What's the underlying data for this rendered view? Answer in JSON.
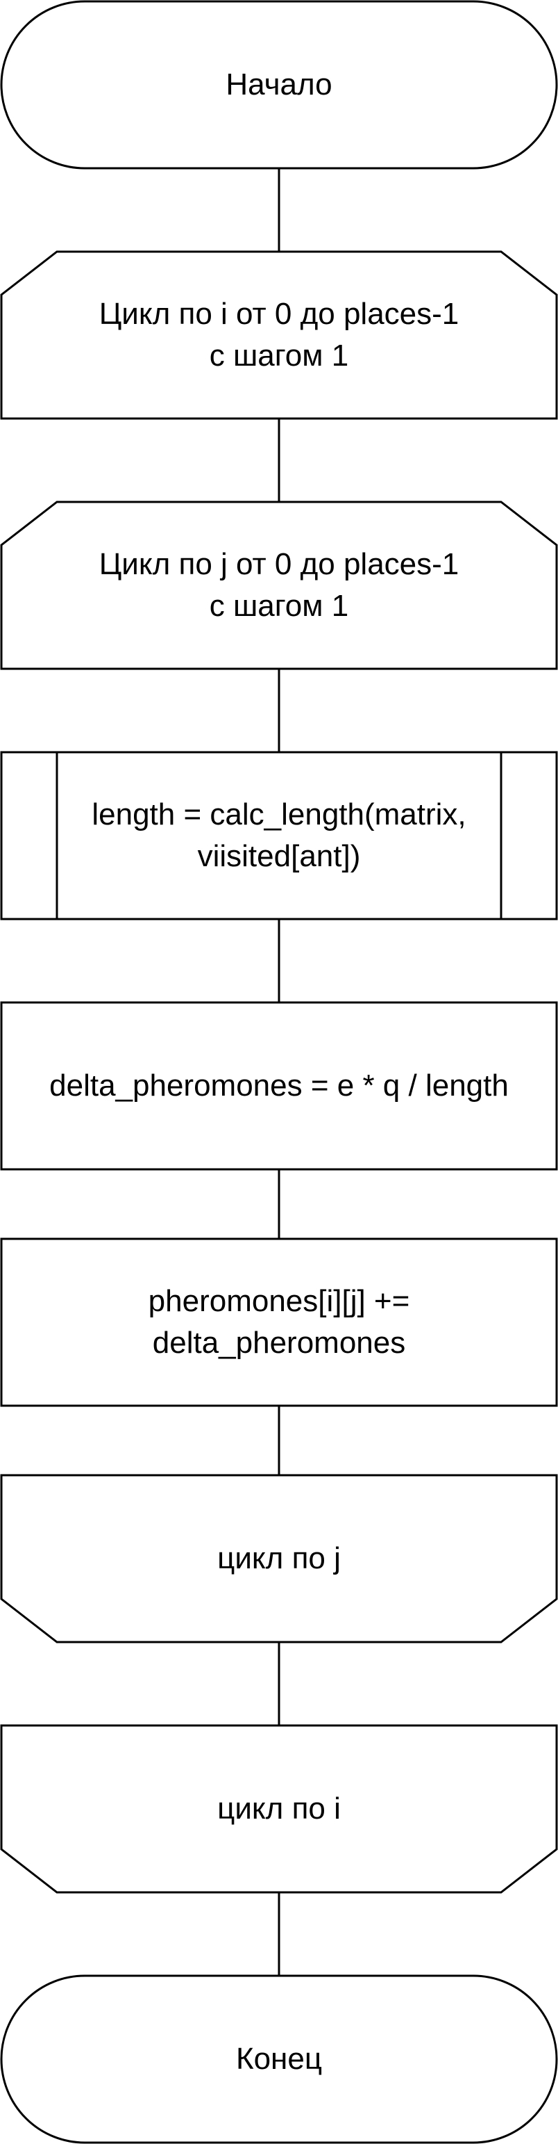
{
  "diagram": {
    "nodes": [
      {
        "id": "start",
        "shape": "terminator",
        "text": "Начало"
      },
      {
        "id": "loop-i-start",
        "shape": "loop-start",
        "text": "Цикл по i от 0 до places-1\nс шагом 1"
      },
      {
        "id": "loop-j-start",
        "shape": "loop-start",
        "text": "Цикл по j от 0 до places-1\nс шагом 1"
      },
      {
        "id": "calc-length",
        "shape": "predefined-process",
        "text": "length = calc_length(matrix,\nviisited[ant])"
      },
      {
        "id": "delta",
        "shape": "process",
        "text": "delta_pheromones = e * q / length"
      },
      {
        "id": "update",
        "shape": "process",
        "text": "pheromones[i][j] +=\ndelta_pheromones"
      },
      {
        "id": "loop-j-end",
        "shape": "loop-end",
        "text": "цикл по j"
      },
      {
        "id": "loop-i-end",
        "shape": "loop-end",
        "text": "цикл по i"
      },
      {
        "id": "end",
        "shape": "terminator",
        "text": "Конец"
      }
    ],
    "edges": [
      {
        "from": "start",
        "to": "loop-i-start"
      },
      {
        "from": "loop-i-start",
        "to": "loop-j-start"
      },
      {
        "from": "loop-j-start",
        "to": "calc-length"
      },
      {
        "from": "calc-length",
        "to": "delta"
      },
      {
        "from": "delta",
        "to": "update"
      },
      {
        "from": "update",
        "to": "loop-j-end"
      },
      {
        "from": "loop-j-end",
        "to": "loop-i-end"
      },
      {
        "from": "loop-i-end",
        "to": "end"
      }
    ]
  }
}
